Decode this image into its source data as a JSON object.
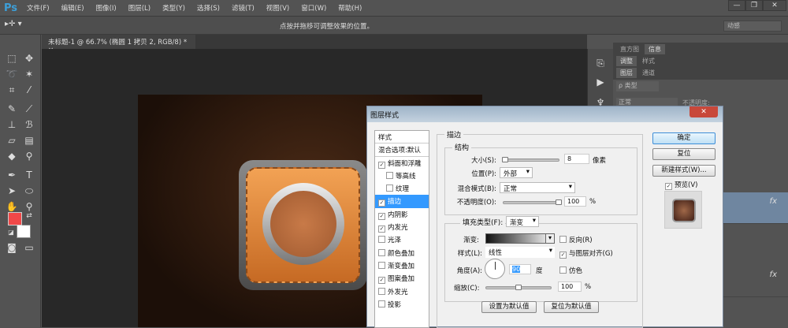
{
  "app": {
    "logo": "Ps",
    "menus": [
      "文件(F)",
      "编辑(E)",
      "图像(I)",
      "图层(L)",
      "类型(Y)",
      "选择(S)",
      "滤镜(T)",
      "视图(V)",
      "窗口(W)",
      "帮助(H)"
    ],
    "window_buttons": [
      "—",
      "❐",
      "✕"
    ]
  },
  "options": {
    "tool_preset": "▸✛ ▾",
    "hint": "点按并拖移可调整效果的位置。",
    "workspace": "动感"
  },
  "document": {
    "tab": "未标题-1 @ 66.7% (椭圆 1 拷贝 2, RGB/8) * ×"
  },
  "colors": {
    "foreground": "#f04848",
    "background": "#ffffff"
  },
  "panels": {
    "row1": [
      "直方图",
      "信息"
    ],
    "row2": [
      "调整",
      "样式"
    ],
    "row3": [
      "图层",
      "通道"
    ],
    "filter": "ρ 类型",
    "blend": "正常",
    "opacity_label": "不透明度:",
    "fx": "fx"
  },
  "dialog": {
    "title": "图层样式",
    "close": "✕",
    "styles": [
      {
        "label": "样式",
        "checkbox": false,
        "header": true
      },
      {
        "label": "混合选项:默认",
        "checkbox": false,
        "header": true
      },
      {
        "label": "斜面和浮雕",
        "checkbox": true,
        "checked": true
      },
      {
        "label": "等高线",
        "checkbox": true,
        "checked": false,
        "indent": true
      },
      {
        "label": "纹理",
        "checkbox": true,
        "checked": false,
        "indent": true
      },
      {
        "label": "描边",
        "checkbox": true,
        "checked": true,
        "selected": true
      },
      {
        "label": "内阴影",
        "checkbox": true,
        "checked": true
      },
      {
        "label": "内发光",
        "checkbox": true,
        "checked": true
      },
      {
        "label": "光泽",
        "checkbox": true,
        "checked": false
      },
      {
        "label": "颜色叠加",
        "checkbox": true,
        "checked": false
      },
      {
        "label": "渐变叠加",
        "checkbox": true,
        "checked": false
      },
      {
        "label": "图案叠加",
        "checkbox": true,
        "checked": true
      },
      {
        "label": "外发光",
        "checkbox": true,
        "checked": false
      },
      {
        "label": "投影",
        "checkbox": true,
        "checked": false
      }
    ],
    "section": "描边",
    "structure": "结构",
    "size_label": "大小(S):",
    "size_value": "8",
    "size_unit": "像素",
    "size_slider": 0.03,
    "position_label": "位置(P):",
    "position_value": "外部",
    "blend_label": "混合模式(B):",
    "blend_value": "正常",
    "opacity_label": "不透明度(O):",
    "opacity_value": "100",
    "opacity_unit": "%",
    "opacity_slider": 1.0,
    "fill_type_label": "填充类型(F):",
    "fill_type_value": "渐变",
    "gradient_label": "渐变:",
    "reverse_label": "反向(R)",
    "reverse_checked": false,
    "style_label": "样式(L):",
    "style_value": "线性",
    "align_label": "与图层对齐(G)",
    "align_checked": true,
    "angle_label": "角度(A):",
    "angle_value": "90",
    "angle_unit": "度",
    "dither_label": "仿色",
    "dither_checked": false,
    "scale_label": "缩放(C):",
    "scale_value": "100",
    "scale_unit": "%",
    "scale_slider": 0.5,
    "set_default": "设置为默认值",
    "reset_default": "复位为默认值",
    "ok": "确定",
    "reset": "复位",
    "new_style": "新建样式(W)...",
    "preview_label": "预览(V)",
    "preview_checked": true
  }
}
